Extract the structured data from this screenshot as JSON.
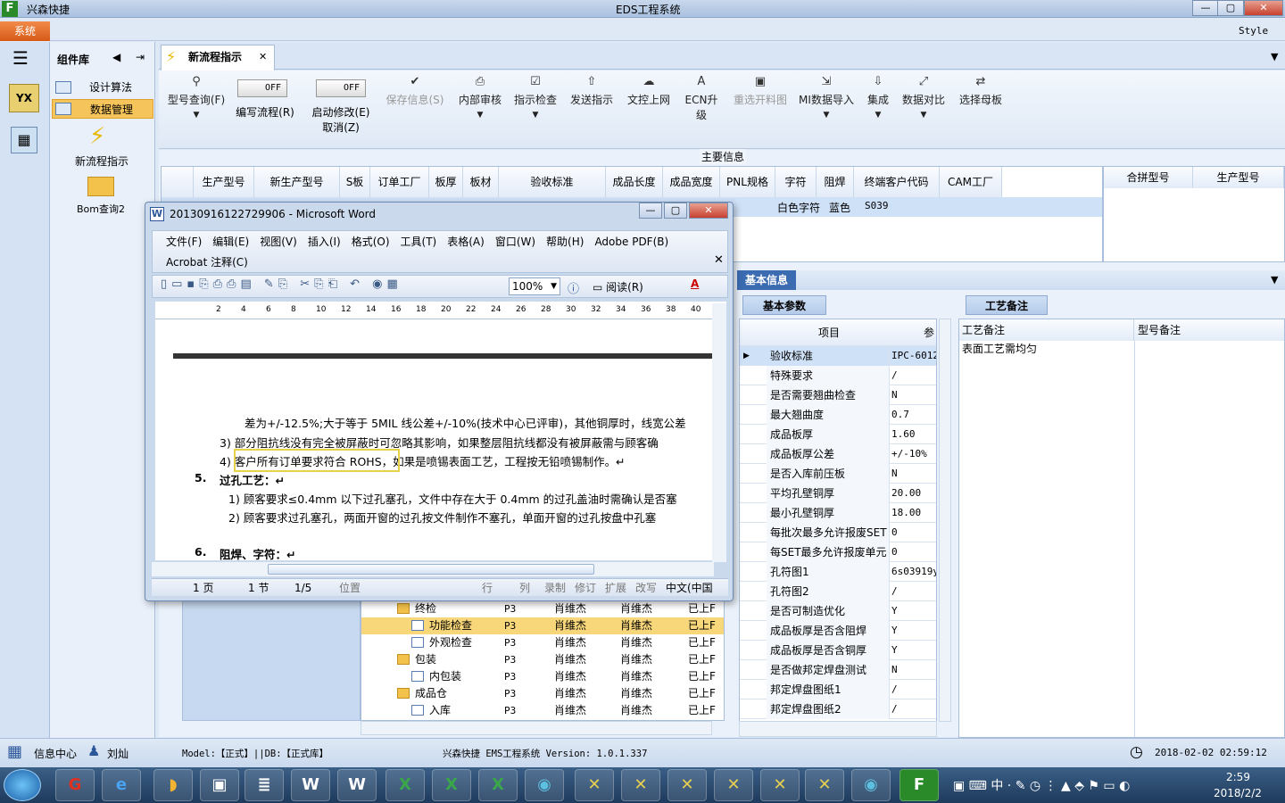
{
  "app": {
    "name": "兴森快捷",
    "window_title": "EDS工程系统",
    "system_button": "系统",
    "style_label": "Style"
  },
  "left_panel": {
    "title": "组件库",
    "items": [
      "设计算法",
      "数据管理"
    ],
    "big_items": [
      "新流程指示",
      "Bom查询2"
    ]
  },
  "tab": {
    "label": "新流程指示"
  },
  "toolbar": {
    "type_query": "型号查询(F)",
    "toggle1_state": "OFF",
    "toggle1_label": "编写流程(R)",
    "toggle2_state": "OFF",
    "toggle2_label": "启动修改(E)",
    "toggle2_sub": "取消(Z)",
    "save_info": "保存信息(S)",
    "internal_review": "内部审核",
    "instruct_check": "指示检查",
    "send_instruct": "发送指示",
    "upload": "文控上网",
    "ecn": "ECN升级",
    "reselect": "重选开料图",
    "mi_import": "MI数据导入",
    "integrate": "集成",
    "compare": "数据对比",
    "select_board": "选择母板"
  },
  "main_info": {
    "label": "主要信息",
    "columns": [
      "生产型号",
      "新生产型号",
      "S板",
      "订单工厂",
      "板厚",
      "板材",
      "验收标准",
      "成品长度",
      "成品宽度",
      "PNL规格",
      "字符",
      "阻焊",
      "终端客户代码",
      "CAM工厂"
    ],
    "row": {
      "char": "白色字符",
      "mask": "蓝色",
      "customer_code": "S039"
    },
    "right_columns": [
      "合拼型号",
      "生产型号"
    ]
  },
  "basic_info": {
    "label": "基本信息",
    "params_tab": "基本参数",
    "craft_tab": "工艺备注",
    "params_header": [
      "项目",
      "参"
    ],
    "params": [
      {
        "k": "验收标准",
        "v": "IPC-6012"
      },
      {
        "k": "特殊要求",
        "v": "/"
      },
      {
        "k": "是否需要翘曲检查",
        "v": "N"
      },
      {
        "k": "最大翘曲度",
        "v": "0.7"
      },
      {
        "k": "成品板厚",
        "v": "1.60"
      },
      {
        "k": "成品板厚公差",
        "v": "+/-10%"
      },
      {
        "k": "是否入库前压板",
        "v": "N"
      },
      {
        "k": "平均孔壁铜厚",
        "v": "20.00"
      },
      {
        "k": "最小孔壁铜厚",
        "v": "18.00"
      },
      {
        "k": "每批次最多允许报废SET",
        "v": "0"
      },
      {
        "k": "每SET最多允许报废单元",
        "v": "0"
      },
      {
        "k": "孔符图1",
        "v": "6s03919y"
      },
      {
        "k": "孔符图2",
        "v": "/"
      },
      {
        "k": "是否可制造优化",
        "v": "Y"
      },
      {
        "k": "成品板厚是否含阻焊",
        "v": "Y"
      },
      {
        "k": "成品板厚是否含铜厚",
        "v": "Y"
      },
      {
        "k": "是否做邦定焊盘测试",
        "v": "N"
      },
      {
        "k": "邦定焊盘图纸1",
        "v": "/"
      },
      {
        "k": "邦定焊盘图纸2",
        "v": "/"
      }
    ],
    "craft_header": [
      "工艺备注",
      "型号备注"
    ],
    "craft_note": "表面工艺需均匀"
  },
  "tree": {
    "rows": [
      {
        "name": "终检",
        "p": "P3",
        "a": "肖维杰",
        "b": "肖维杰",
        "s": "已上F"
      },
      {
        "name": "功能检查",
        "p": "P3",
        "a": "肖维杰",
        "b": "肖维杰",
        "s": "已上F"
      },
      {
        "name": "外观检查",
        "p": "P3",
        "a": "肖维杰",
        "b": "肖维杰",
        "s": "已上F"
      },
      {
        "name": "包装",
        "p": "P3",
        "a": "肖维杰",
        "b": "肖维杰",
        "s": "已上F"
      },
      {
        "name": "内包装",
        "p": "P3",
        "a": "肖维杰",
        "b": "肖维杰",
        "s": "已上F"
      },
      {
        "name": "成品仓",
        "p": "P3",
        "a": "肖维杰",
        "b": "肖维杰",
        "s": "已上F"
      },
      {
        "name": "入库",
        "p": "P3",
        "a": "肖维杰",
        "b": "肖维杰",
        "s": "已上F"
      }
    ]
  },
  "word": {
    "title": "20130916122729906 - Microsoft Word",
    "menu": [
      "文件(F)",
      "编辑(E)",
      "视图(V)",
      "插入(I)",
      "格式(O)",
      "工具(T)",
      "表格(A)",
      "窗口(W)",
      "帮助(H)",
      "Adobe PDF(B)"
    ],
    "menu2": "Acrobat 注释(C)",
    "zoom": "100%",
    "read_mode": "阅读(R)",
    "ruler": [
      "2",
      "4",
      "6",
      "8",
      "10",
      "12",
      "14",
      "16",
      "18",
      "20",
      "22",
      "24",
      "26",
      "28",
      "30",
      "32",
      "34",
      "36",
      "38",
      "40"
    ],
    "lines": [
      "差为+/-12.5%;大于等于 5MIL 线公差+/-10%(技术中心已评审)，其他铜厚时，线宽公差",
      "3) 部分阻抗线没有完全被屏蔽时可忽略其影响，如果整层阻抗线都没有被屏蔽需与顾客确",
      "4) 客户所有订单要求符合 ROHS，如果是喷锡表面工艺，工程按无铅喷锡制作。↵",
      "5.",
      "过孔工艺：↵",
      "1) 顾客要求≤0.4mm 以下过孔塞孔，文件中存在大于 0.4mm 的过孔盖油时需确认是否塞",
      "2) 顾客要求过孔塞孔，两面开窗的过孔按文件制作不塞孔，单面开窗的过孔按盘中孔塞",
      "6.",
      "阻焊、字符：↵"
    ],
    "status": {
      "page": "1 页",
      "section": "1 节",
      "pages": "1/5",
      "pos": "位置",
      "row": "行",
      "col": "列",
      "rec": "录制",
      "rev": "修订",
      "ext": "扩展",
      "ovr": "改写",
      "lang": "中文(中国"
    }
  },
  "statusbar": {
    "info_center": "信息中心",
    "user": "刘灿",
    "model": "Model:【正式】||DB:【正式库】",
    "system": "兴森快捷 EMS工程系统  Version: 1.0.1.337",
    "datetime": "2018-02-02 02:59:12"
  },
  "taskbar": {
    "time": "2:59",
    "date": "2018/2/2",
    "ime": "中"
  }
}
